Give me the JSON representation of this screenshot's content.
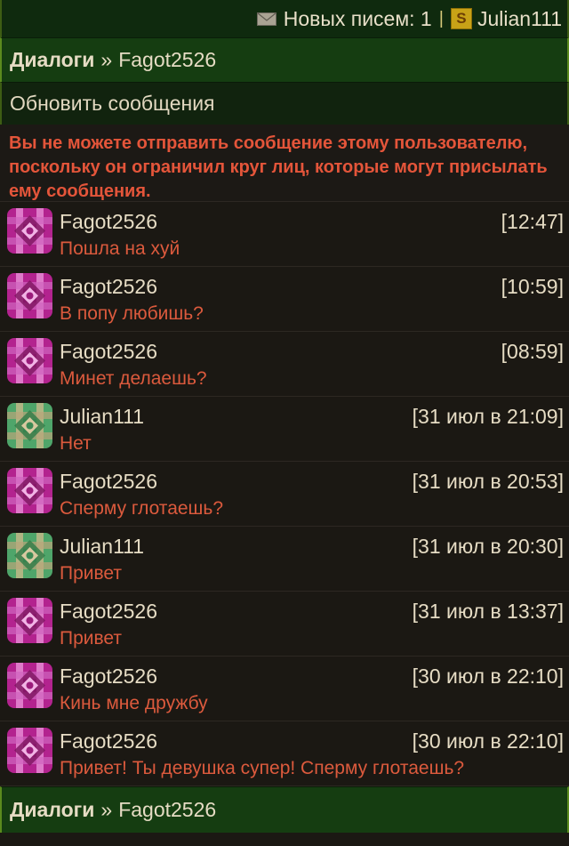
{
  "header": {
    "mail_icon": "envelope-icon",
    "new_mail_text": "Новых писем: 1",
    "separator": "|",
    "coin_icon": "coin-s-icon",
    "coin_letter": "S",
    "username": "Julian111"
  },
  "breadcrumb": {
    "section": "Диалоги",
    "separator": "»",
    "partner": "Fagot2526"
  },
  "refresh_label": "Обновить сообщения",
  "warning": "Вы не можете отправить сообщение этому пользователю, поскольку он ограничил круг лиц, которые могут присылать ему сообщения.",
  "colors": {
    "header_bg": "#0f2a0e",
    "bar_bg": "#153d11",
    "page_bg": "#1b1813",
    "warning_text": "#e4553a",
    "message_text": "#dc5a3d",
    "avatar_purple": "#b3238f",
    "avatar_green": "#4fa56a"
  },
  "messages": [
    {
      "author": "Fagot2526",
      "time": "[12:47]",
      "text": "Пошла на хуй",
      "avatar": "purple"
    },
    {
      "author": "Fagot2526",
      "time": "[10:59]",
      "text": "В попу любишь?",
      "avatar": "purple"
    },
    {
      "author": "Fagot2526",
      "time": "[08:59]",
      "text": "Минет делаешь?",
      "avatar": "purple"
    },
    {
      "author": "Julian111",
      "time": "[31 июл в 21:09]",
      "text": "Нет",
      "avatar": "green"
    },
    {
      "author": "Fagot2526",
      "time": "[31 июл в 20:53]",
      "text": "Сперму глотаешь?",
      "avatar": "purple"
    },
    {
      "author": "Julian111",
      "time": "[31 июл в 20:30]",
      "text": "Привет",
      "avatar": "green"
    },
    {
      "author": "Fagot2526",
      "time": "[31 июл в 13:37]",
      "text": "Привет",
      "avatar": "purple"
    },
    {
      "author": "Fagot2526",
      "time": "[30 июл в 22:10]",
      "text": "Кинь мне дружбу",
      "avatar": "purple"
    },
    {
      "author": "Fagot2526",
      "time": "[30 июл в 22:10]",
      "text": "Привет! Ты девушка супер! Сперму глотаешь?",
      "avatar": "purple"
    }
  ]
}
